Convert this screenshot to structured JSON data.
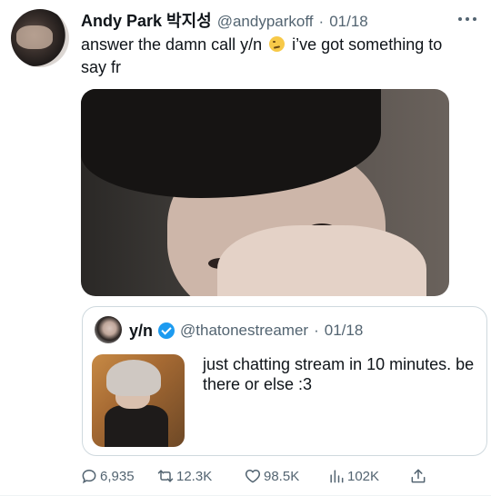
{
  "tweet": {
    "display_name": "Andy Park 박지성",
    "handle": "@andyparkoff",
    "separator": "·",
    "date": "01/18",
    "text_before_emoji": "answer the damn call y/n",
    "emoji_icon": "smirking-face-emoji",
    "text_after_emoji": " i’ve got something to say fr"
  },
  "quote": {
    "display_name": "y/n",
    "verified_icon": "verified-badge-icon",
    "handle": "@thatonestreamer",
    "separator": "·",
    "date": "01/18",
    "text": "just chatting stream in 10 minutes. be there or else :3"
  },
  "actions": {
    "replies": "6,935",
    "retweets": "12.3K",
    "likes": "98.5K",
    "views": "102K"
  },
  "colors": {
    "text_primary": "#0f1419",
    "text_secondary": "#536471",
    "verified_blue": "#1d9bf0",
    "border": "#cfd9de"
  }
}
